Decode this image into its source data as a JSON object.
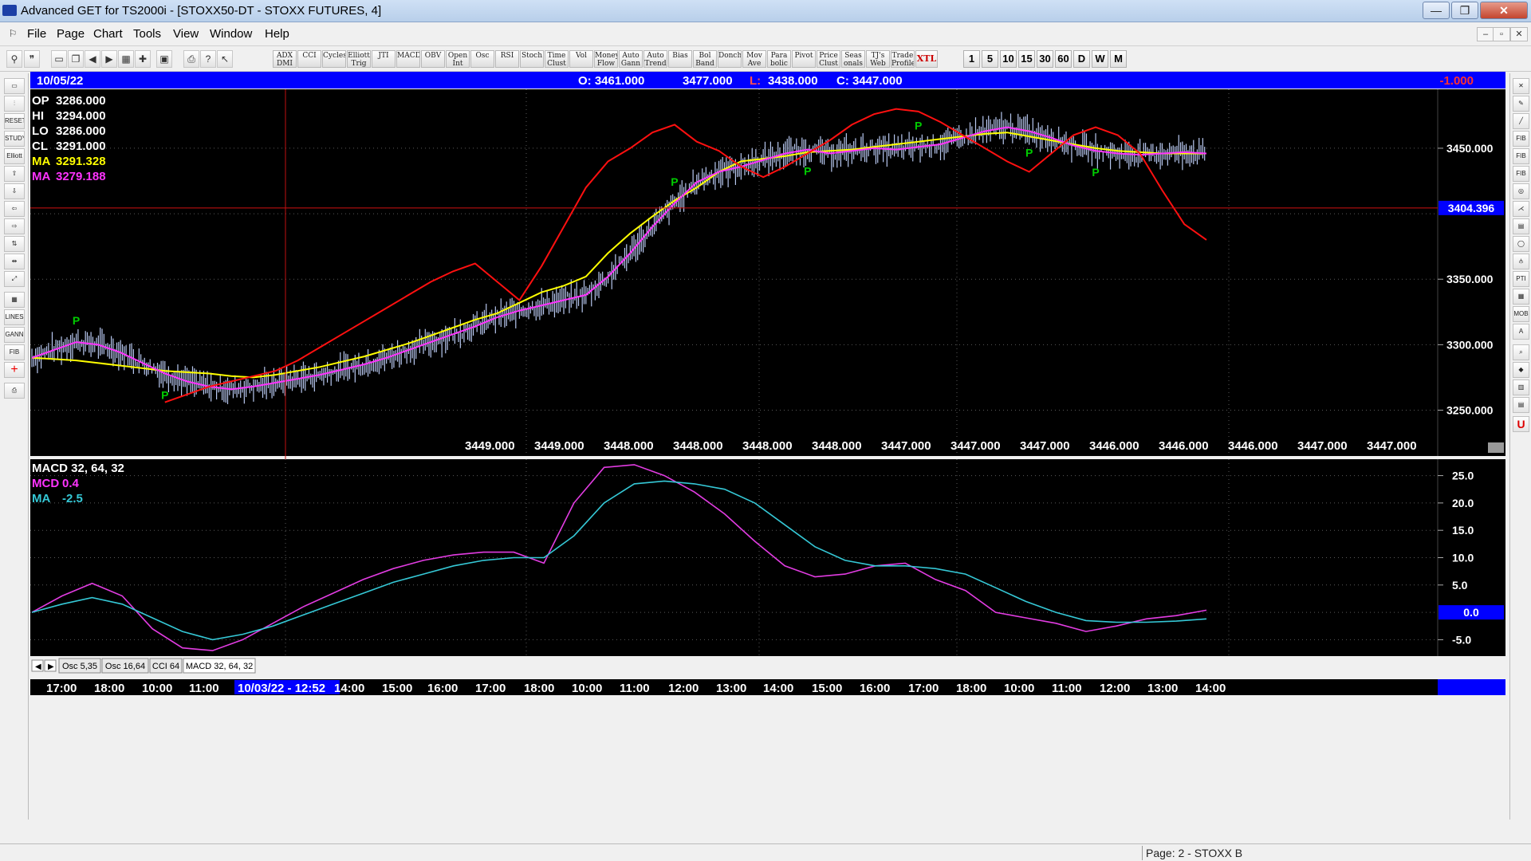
{
  "window": {
    "title": "Advanced GET for TS2000i - [STOXX50-DT - STOXX FUTURES, 4]",
    "minimize": "—",
    "maximize": "❐",
    "close": "✕"
  },
  "menu": [
    "File",
    "Page",
    "Chart",
    "Tools",
    "View",
    "Window",
    "Help"
  ],
  "mdi_controls": [
    "–",
    "▫",
    "✕"
  ],
  "toolbar": {
    "studies": [
      "ADX DMI",
      "CCI",
      "Cycles",
      "Elliott Trig",
      "JTI",
      "MACD",
      "OBV",
      "Open Int",
      "Osc",
      "RSI",
      "Stoch",
      "Time Clust",
      "Vol",
      "Money Flow",
      "Auto Gann",
      "Auto Trend",
      "Bias",
      "Bol Band",
      "Donch",
      "Mov Ave",
      "Para bolic",
      "Pivot",
      "Price Clust",
      "Seas onals",
      "TJ's Web",
      "Trade Profile",
      "XTL"
    ],
    "timeframes": [
      "1",
      "5",
      "10",
      "15",
      "30",
      "60",
      "D",
      "W",
      "M"
    ]
  },
  "header": {
    "date": "10/05/22",
    "open": "O: 3461.000",
    "high": "3477.000",
    "low_label": "L:",
    "low": "3438.000",
    "close": "C: 3447.000",
    "change": "-1.000"
  },
  "price_panel": {
    "info": [
      {
        "label": "OP",
        "value": "3286.000",
        "color": "#ffffff"
      },
      {
        "label": "HI",
        "value": "3294.000",
        "color": "#ffffff"
      },
      {
        "label": "LO",
        "value": "3286.000",
        "color": "#ffffff"
      },
      {
        "label": "CL",
        "value": "3291.000",
        "color": "#ffffff"
      },
      {
        "label": "MA",
        "value": "3291.328",
        "color": "#ffff00"
      },
      {
        "label": "MA",
        "value": "3279.188",
        "color": "#ff33ff"
      }
    ],
    "yticks": [
      "3450.000",
      "3350.000",
      "3300.000",
      "3250.000"
    ],
    "hline_label": "3404.396",
    "pivot_marker": "P",
    "bottom_values": [
      "3449.000",
      "3449.000",
      "3448.000",
      "3448.000",
      "3448.000",
      "3448.000",
      "3447.000",
      "3447.000",
      "3447.000",
      "3446.000",
      "3446.000",
      "3446.000",
      "3447.000",
      "3447.000"
    ]
  },
  "macd_panel": {
    "title": "MACD 32, 64, 32",
    "mcd_label": "MCD",
    "mcd_value": "0.4",
    "ma_label": "MA",
    "ma_value": "-2.5",
    "yticks": [
      "25.0",
      "20.0",
      "15.0",
      "10.0",
      "5.0",
      "-5.0"
    ],
    "zero_label": "0.0"
  },
  "indicator_tabs": [
    "Osc 5,35",
    "Osc 16,64",
    "CCI 64",
    "MACD 32, 64, 32"
  ],
  "time_axis": {
    "labels": [
      "17:00",
      "18:00",
      "10:00",
      "11:00",
      "10/03/22 - 12:52",
      "14:00",
      "15:00",
      "16:00",
      "17:00",
      "18:00",
      "10:00",
      "11:00",
      "12:00",
      "13:00",
      "14:00",
      "15:00",
      "16:00",
      "17:00",
      "18:00",
      "10:00",
      "11:00",
      "12:00",
      "13:00",
      "14:00"
    ]
  },
  "status": {
    "page": "Page: 2 - STOXX B"
  },
  "colors": {
    "chart_bg": "#000000",
    "header_bar": "#0000ff",
    "ma_fast": "#ffff00",
    "ma_slow": "#ff33ff",
    "ma_red": "#ff1010",
    "macd_line": "#e23ce2",
    "macd_signal": "#35c8d6",
    "bars": "#b8c8f0",
    "pivot": "#00cc00"
  },
  "chart_data": [
    {
      "type": "candlestick",
      "ylim": [
        3215,
        3495
      ],
      "yticks": [
        3450,
        3400,
        3350,
        3300,
        3250
      ],
      "hline": 3404.396,
      "series": [
        {
          "name": "MA",
          "values": [
            3290,
            3289,
            3288,
            3286,
            3284,
            3282,
            3280,
            3279,
            3278,
            3276,
            3275,
            3277,
            3280,
            3283,
            3287,
            3291,
            3296,
            3301,
            3307,
            3313,
            3319,
            3324,
            3332,
            3340,
            3345,
            3352,
            3370,
            3385,
            3398,
            3410,
            3420,
            3432,
            3440,
            3442,
            3444,
            3447,
            3448,
            3449,
            3451,
            3453,
            3455,
            3457,
            3459,
            3461,
            3462,
            3459,
            3456,
            3453,
            3450,
            3448,
            3447,
            3446,
            3446,
            3446
          ]
        },
        {
          "name": "MA",
          "values": [
            3290,
            3296,
            3302,
            3300,
            3294,
            3286,
            3278,
            3272,
            3268,
            3266,
            3268,
            3271,
            3274,
            3277,
            3281,
            3285,
            3290,
            3296,
            3302,
            3308,
            3314,
            3321,
            3326,
            3330,
            3334,
            3338,
            3352,
            3370,
            3390,
            3408,
            3424,
            3432,
            3436,
            3441,
            3446,
            3449,
            3446,
            3448,
            3450,
            3449,
            3451,
            3453,
            3458,
            3463,
            3466,
            3463,
            3458,
            3452,
            3448,
            3446,
            3445,
            3446,
            3447,
            3446
          ]
        },
        {
          "name": "MA",
          "values": [
            null,
            null,
            null,
            null,
            null,
            null,
            3256,
            3262,
            3268,
            3272,
            3276,
            3280,
            3288,
            3298,
            3308,
            3318,
            3328,
            3338,
            3348,
            3356,
            3362,
            3348,
            3334,
            3360,
            3390,
            3420,
            3440,
            3450,
            3462,
            3468,
            3455,
            3448,
            3436,
            3428,
            3436,
            3446,
            3456,
            3468,
            3476,
            3480,
            3478,
            3470,
            3460,
            3450,
            3440,
            3432,
            3446,
            3460,
            3466,
            3460,
            3446,
            3418,
            3392,
            3380
          ]
        }
      ]
    },
    {
      "type": "line",
      "title": "MACD 32, 64, 32",
      "ylim": [
        -8,
        28
      ],
      "yticks": [
        25,
        20,
        15,
        10,
        5,
        0,
        -5
      ],
      "series": [
        {
          "name": "MCD",
          "values": [
            0,
            3,
            5.3,
            3,
            -3,
            -6.5,
            -7,
            -5,
            -2,
            1,
            3.5,
            6,
            8,
            9.5,
            10.5,
            11,
            11,
            9,
            20,
            26.5,
            27,
            25,
            22,
            18,
            13,
            8.5,
            6.5,
            7,
            8.5,
            9,
            6,
            4,
            0,
            -1,
            -2,
            -3.5,
            -2.5,
            -1.2,
            -0.6,
            0.4
          ]
        },
        {
          "name": "MA",
          "values": [
            0,
            1.5,
            2.7,
            1.5,
            -1,
            -3.5,
            -5,
            -4,
            -2.5,
            -0.5,
            1.5,
            3.5,
            5.5,
            7,
            8.5,
            9.5,
            10,
            10,
            14,
            20,
            23.5,
            24,
            23.5,
            22.5,
            20,
            16,
            12,
            9.5,
            8.5,
            8.5,
            8,
            7,
            4.5,
            2,
            0,
            -1.5,
            -1.8,
            -1.8,
            -1.6,
            -1.2
          ]
        }
      ]
    }
  ]
}
